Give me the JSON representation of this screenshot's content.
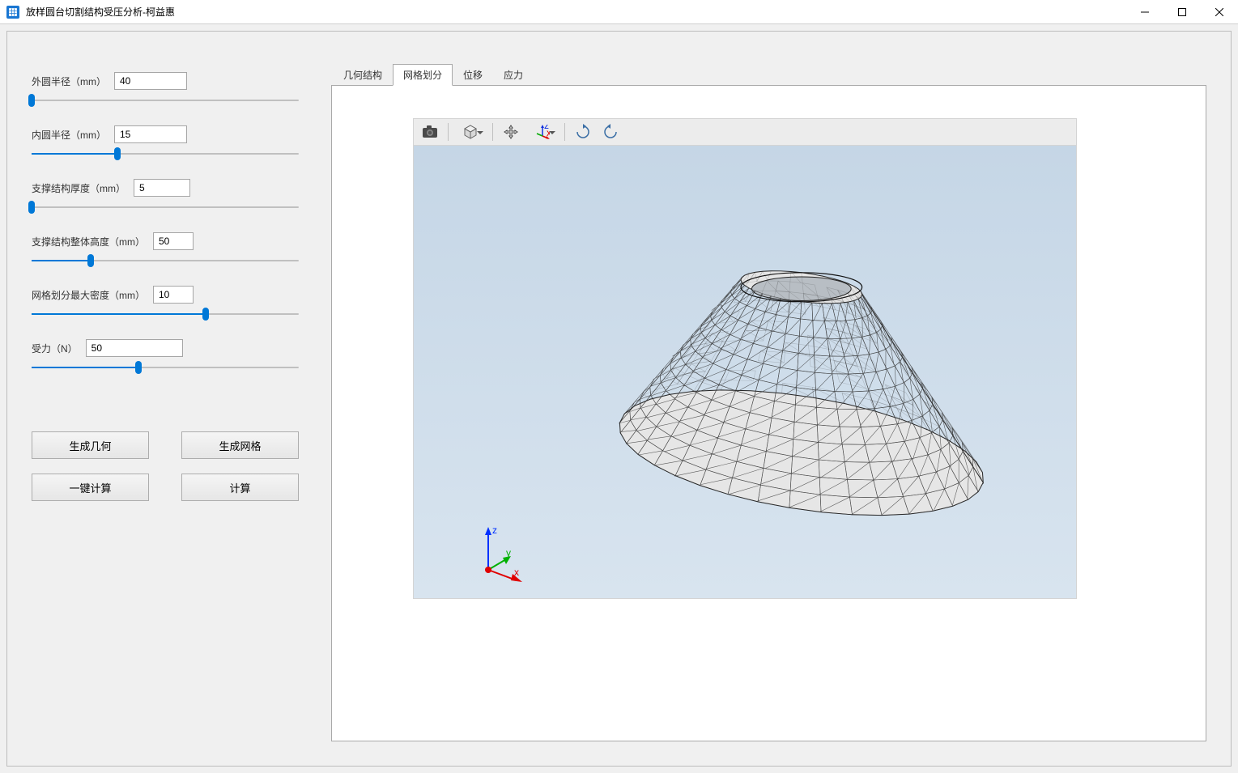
{
  "window": {
    "title": "放样圆台切割结构受压分析-柯益惠"
  },
  "params": {
    "outer_radius": {
      "label": "外圆半径（mm）",
      "value": "40",
      "pos": 0
    },
    "inner_radius": {
      "label": "内圆半径（mm）",
      "value": "15",
      "pos": 32
    },
    "thickness": {
      "label": "支撑结构厚度（mm）",
      "value": "5",
      "pos": 0
    },
    "height": {
      "label": "支撑结构整体高度（mm）",
      "value": "50",
      "pos": 22
    },
    "mesh_density": {
      "label": "网格划分最大密度（mm）",
      "value": "10",
      "pos": 65
    },
    "force": {
      "label": "受力（N）",
      "value": "50",
      "pos": 40
    }
  },
  "buttons": {
    "gen_geometry": "生成几何",
    "gen_mesh": "生成网格",
    "one_click": "一键计算",
    "compute": "计算"
  },
  "tabs": {
    "geometry": "几何结构",
    "mesh": "网格划分",
    "displacement": "位移",
    "stress": "应力",
    "active": "mesh"
  },
  "toolbar_icons": {
    "screenshot": "camera-icon",
    "fit_view": "fit-box-icon",
    "pan": "pan-icon",
    "axes": "axes-icon",
    "rotate_cw": "rotate-cw-icon",
    "rotate_ccw": "rotate-ccw-icon"
  },
  "triad": {
    "x": "x",
    "y": "y",
    "z": "z"
  }
}
